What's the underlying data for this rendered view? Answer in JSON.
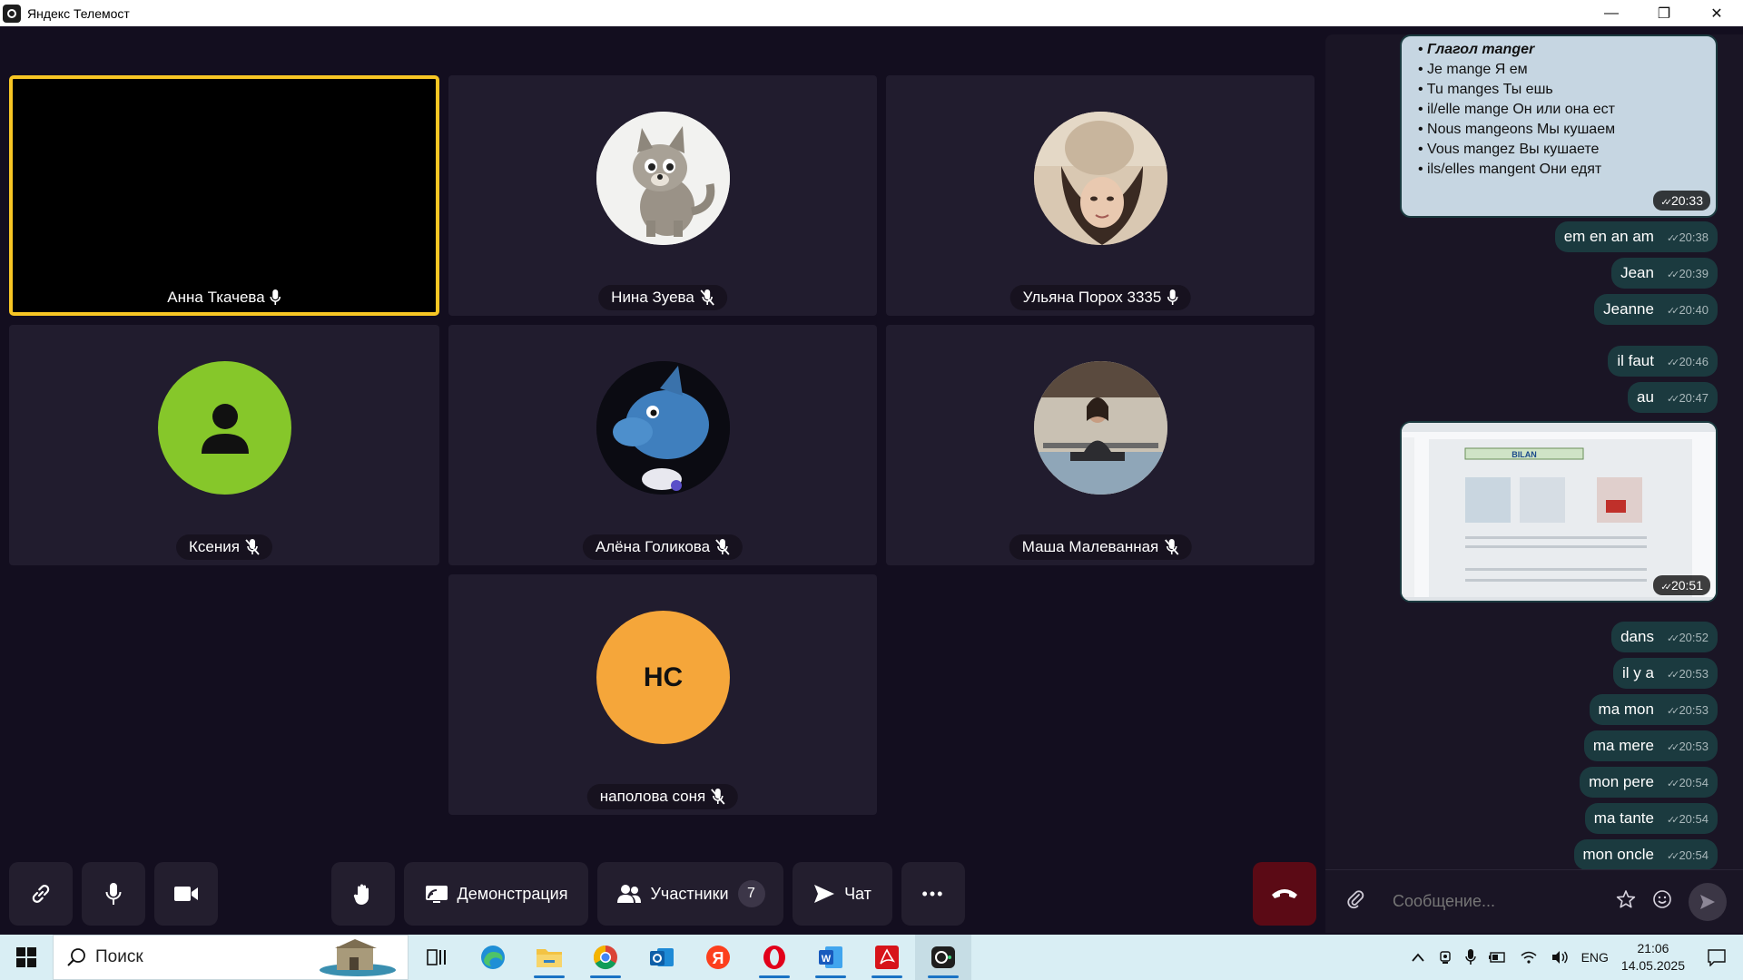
{
  "window": {
    "title": "Яндекс Телемост",
    "minimize": "—",
    "restore": "❐",
    "close": "✕"
  },
  "participants": [
    {
      "name": "Анна Ткачева",
      "mic": "on",
      "active": true
    },
    {
      "name": "Нина Зуева",
      "mic": "off"
    },
    {
      "name": "Ульяна Порох 3335",
      "mic": "on"
    },
    {
      "name": "Ксения",
      "mic": "off"
    },
    {
      "name": "Алёна Голикова",
      "mic": "off"
    },
    {
      "name": "Маша Малеванная",
      "mic": "off"
    },
    {
      "name": "наполова соня",
      "mic": "off",
      "initials": "НС"
    }
  ],
  "chat": {
    "slide_lines": [
      "Глагол manger",
      "Je mange  Я ем",
      "Tu manges Ты ешь",
      "il/elle mange Он или она ест",
      "Nous mangeons Мы кушаем",
      "Vous mangez Вы кушаете",
      "ils/elles mangent Они едят"
    ],
    "slide_time": "20:33",
    "screenshot_title": "BILAN",
    "screenshot_time": "20:51",
    "messages": [
      {
        "text": "em en an am",
        "time": "20:38"
      },
      {
        "text": "Jean",
        "time": "20:39"
      },
      {
        "text": "Jeanne",
        "time": "20:40"
      },
      {
        "text": "il faut",
        "time": "20:46"
      },
      {
        "text": "au",
        "time": "20:47"
      },
      {
        "text": "dans",
        "time": "20:52"
      },
      {
        "text": "il y a",
        "time": "20:53"
      },
      {
        "text": "ma mon",
        "time": "20:53"
      },
      {
        "text": "ma mere",
        "time": "20:53"
      },
      {
        "text": "mon pere",
        "time": "20:54"
      },
      {
        "text": "ma tante",
        "time": "20:54"
      },
      {
        "text": "mon oncle",
        "time": "20:54"
      }
    ],
    "composer_placeholder": "Сообщение..."
  },
  "toolbar": {
    "demo_label": "Демонстрация",
    "participants_label": "Участники",
    "participants_count": "7",
    "chat_label": "Чат",
    "more_label": "•••"
  },
  "taskbar": {
    "search_placeholder": "Поиск",
    "lang": "ENG",
    "time": "21:06",
    "date": "14.05.2025",
    "apps": [
      "task-view",
      "edge",
      "file-explorer",
      "chrome",
      "outlook",
      "yandex-browser",
      "opera",
      "word",
      "acrobat",
      "telemost"
    ]
  },
  "colors": {
    "background": "#130e1f",
    "tile": "#211c2e",
    "active_border": "#f7c624",
    "chat_bubble": "#1b3a3f",
    "hangup": "#5b0a15",
    "avatar_green": "#86c72a",
    "avatar_orange": "#f5a63a"
  }
}
